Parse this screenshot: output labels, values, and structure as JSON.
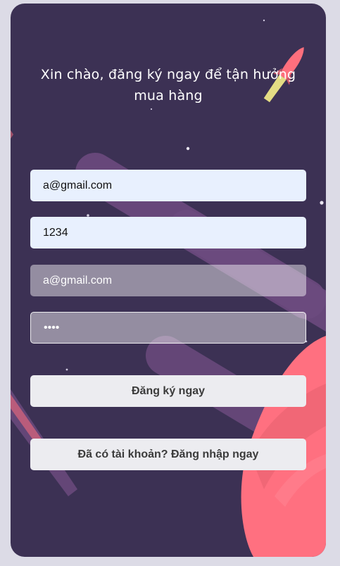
{
  "heading": "Xin chào, đăng ký ngay để tận hưởng mua hàng",
  "form": {
    "field1_value": "a@gmail.com",
    "field2_value": "1234",
    "field3_value": "a@gmail.com",
    "field4_value": "••••"
  },
  "buttons": {
    "register_label": "Đăng ký ngay",
    "login_label": "Đã có tài khoản? Đăng nhập ngay"
  },
  "colors": {
    "card_background": "#3c3154",
    "planet": "#ff7080",
    "band": "#6b4a7e",
    "autofill_field": "#e8f0fe",
    "button": "#ececf0"
  }
}
